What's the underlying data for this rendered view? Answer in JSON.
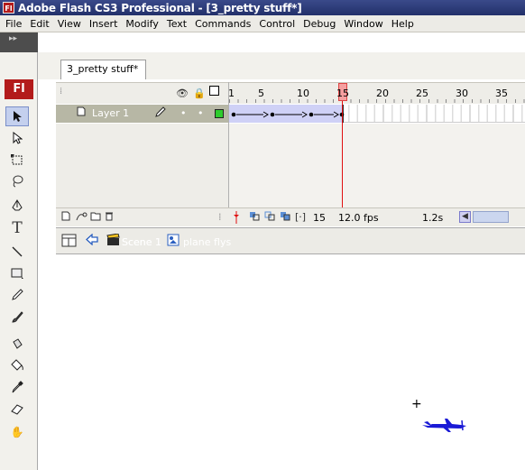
{
  "window": {
    "app_icon_text": "Fl",
    "title": "Adobe Flash CS3 Professional - [3_pretty stuff*]"
  },
  "menu": [
    "File",
    "Edit",
    "View",
    "Insert",
    "Modify",
    "Text",
    "Commands",
    "Control",
    "Debug",
    "Window",
    "Help"
  ],
  "toolbox": {
    "logo_text": "Fl",
    "tools": [
      "selection-tool",
      "subselection-tool",
      "free-transform-tool",
      "lasso-tool",
      "pen-tool",
      "text-tool",
      "line-tool",
      "rectangle-tool",
      "pencil-tool",
      "brush-tool",
      "ink-bottle-tool",
      "paint-bucket-tool",
      "eyedropper-tool",
      "eraser-tool",
      "hand-tool"
    ]
  },
  "document_tab": {
    "label": "3_pretty stuff*"
  },
  "timeline": {
    "frame_numbers": [
      "1",
      "5",
      "10",
      "15",
      "20",
      "25",
      "30",
      "35"
    ],
    "layers": [
      {
        "name": "Layer 1",
        "outline_color": "#2ecc2e"
      }
    ],
    "current_frame": "15",
    "frame_rate": "12.0 fps",
    "elapsed_time": "1.2s"
  },
  "edit_bar": {
    "scene_label": "Scene 1",
    "symbol_label": "plane flys"
  },
  "colors": {
    "titlebar": "#2c3a7a",
    "playhead": "#e01010",
    "plane": "#1a1ad6"
  }
}
